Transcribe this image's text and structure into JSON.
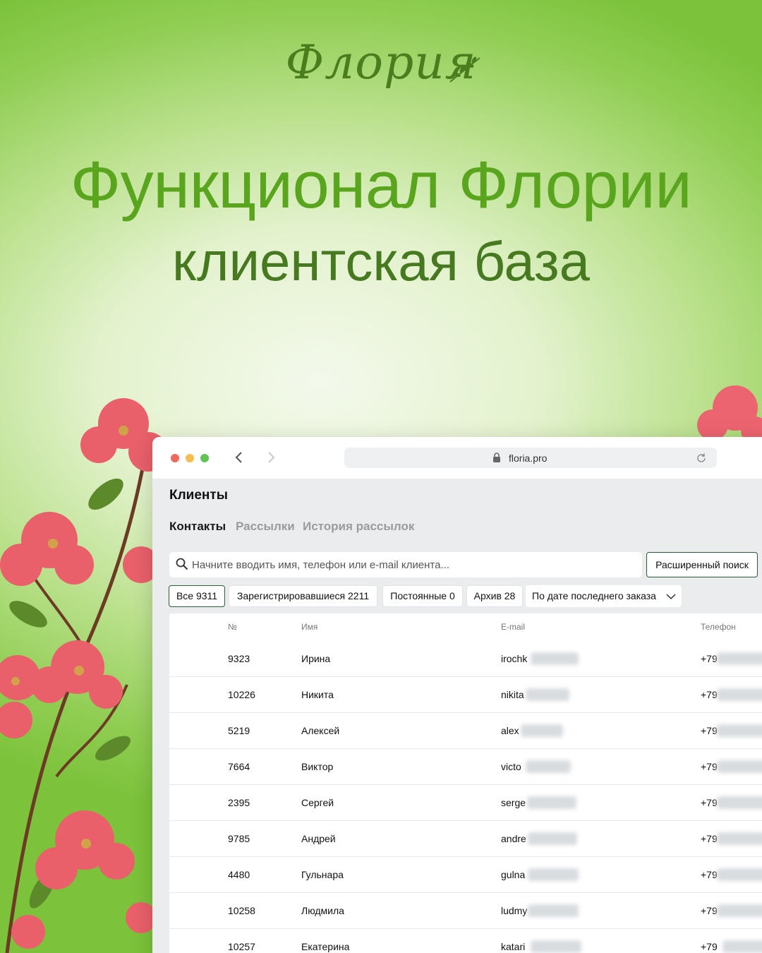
{
  "logo": {
    "text": "Флория"
  },
  "headline": "Функционал Флории",
  "subheadline": "клиентская база",
  "browser": {
    "url": "floria.pro"
  },
  "page": {
    "title": "Клиенты",
    "tabs": [
      {
        "label": "Контакты",
        "active": true
      },
      {
        "label": "Рассылки",
        "active": false
      },
      {
        "label": "История рассылок",
        "active": false
      }
    ],
    "search": {
      "placeholder": "Начните вводить имя, телефон или e-mail клиента...",
      "value": ""
    },
    "advanced_search_label": "Расширенный поиск",
    "filters": [
      {
        "label": "Все 9311",
        "active": true
      },
      {
        "label": "Зарегистрировавшиеся 2211",
        "active": false
      },
      {
        "label": "Постоянные 0",
        "active": false
      },
      {
        "label": "Архив 28",
        "active": false
      }
    ],
    "sort": {
      "selected": "По дате последнего заказа"
    }
  },
  "table": {
    "columns": [
      "№",
      "Имя",
      "E-mail",
      "Телефон"
    ],
    "rows": [
      {
        "num": "9323",
        "name": "Ирина",
        "email": "irochk",
        "phone": "+79"
      },
      {
        "num": "10226",
        "name": "Никита",
        "email": "nikita",
        "phone": "+79"
      },
      {
        "num": "5219",
        "name": "Алексей",
        "email": "alex",
        "phone": "+79"
      },
      {
        "num": "7664",
        "name": "Виктор",
        "email": "victo",
        "phone": "+79"
      },
      {
        "num": "2395",
        "name": "Сергей",
        "email": "serge",
        "phone": "+79"
      },
      {
        "num": "9785",
        "name": "Андрей",
        "email": "andre",
        "phone": "+79"
      },
      {
        "num": "4480",
        "name": "Гульнара",
        "email": "gulna",
        "phone": "+79"
      },
      {
        "num": "10258",
        "name": "Людмила",
        "email": "ludmy",
        "phone": "+79"
      },
      {
        "num": "10257",
        "name": "Екатерина",
        "email": "katari",
        "phone": "+79"
      }
    ]
  },
  "colors": {
    "brand_green": "#5aa51e",
    "dark_green": "#477a20",
    "active_border": "#2b5e35",
    "flower_pink": "#e9606a"
  }
}
